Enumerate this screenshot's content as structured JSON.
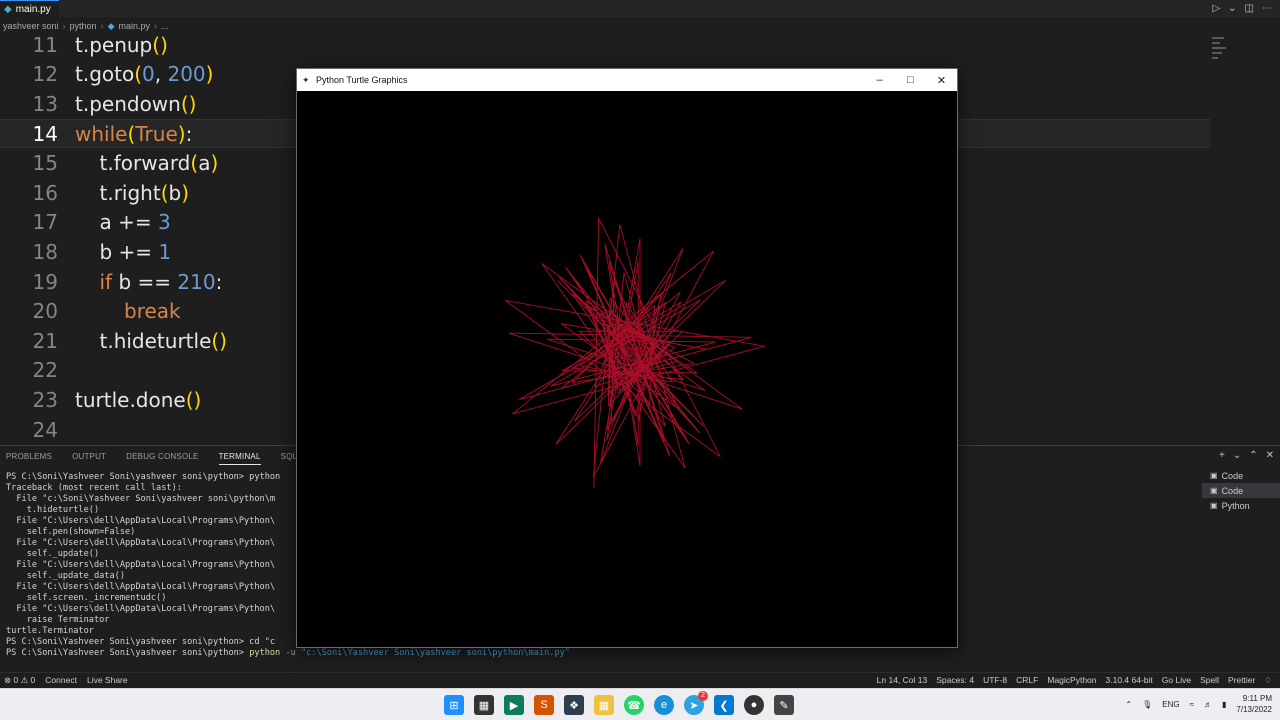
{
  "tab": {
    "icon": "python-file-icon",
    "label": "main.py"
  },
  "breadcrumb": [
    "yashveer soni",
    "python",
    "main.py",
    "..."
  ],
  "code_lines": [
    {
      "n": "11",
      "code": "t.penup()"
    },
    {
      "n": "12",
      "code": "t.goto(0, 200)"
    },
    {
      "n": "13",
      "code": "t.pendown()"
    },
    {
      "n": "14",
      "code": "while(True):"
    },
    {
      "n": "15",
      "code": "t.forward(a)"
    },
    {
      "n": "16",
      "code": "t.right(b)"
    },
    {
      "n": "17",
      "code": "a += 3"
    },
    {
      "n": "18",
      "code": "b += 1"
    },
    {
      "n": "19",
      "code": "if b == 210:"
    },
    {
      "n": "20",
      "code": "break"
    },
    {
      "n": "21",
      "code": "t.hideturtle()"
    },
    {
      "n": "22",
      "code": ""
    },
    {
      "n": "23",
      "code": "turtle.done()"
    },
    {
      "n": "24",
      "code": ""
    }
  ],
  "panel": {
    "tabs": [
      "PROBLEMS",
      "OUTPUT",
      "DEBUG CONSOLE",
      "TERMINAL",
      "SQL CONSOLE"
    ],
    "active_tab": "TERMINAL",
    "terminals": [
      "Code",
      "Code",
      "Python"
    ],
    "terminal_lines": [
      "PS C:\\Soni\\Yashveer Soni\\yashveer soni\\python> python",
      "Traceback (most recent call last):",
      "  File \"c:\\Soni\\Yashveer Soni\\yashveer soni\\python\\m",
      "    t.hideturtle()",
      "  File \"C:\\Users\\dell\\AppData\\Local\\Programs\\Python\\",
      "    self.pen(shown=False)",
      "  File \"C:\\Users\\dell\\AppData\\Local\\Programs\\Python\\",
      "    self._update()",
      "  File \"C:\\Users\\dell\\AppData\\Local\\Programs\\Python\\",
      "    self._update_data()",
      "  File \"C:\\Users\\dell\\AppData\\Local\\Programs\\Python\\",
      "    self.screen._incrementudc()",
      "  File \"C:\\Users\\dell\\AppData\\Local\\Programs\\Python\\",
      "    raise Terminator",
      "turtle.Terminator",
      "PS C:\\Soni\\Yashveer Soni\\yashveer soni\\python> cd \"c"
    ],
    "last_prompt": "PS C:\\Soni\\Yashveer Soni\\yashveer soni\\python> ",
    "last_cmd": "python",
    "last_flag": " -u ",
    "last_arg": "\"c:\\Soni\\Yashveer Soni\\yashveer soni\\python\\main.py\""
  },
  "statusbar": {
    "left": [
      "⊗ 0 ⚠ 0",
      "Connect",
      "Live Share"
    ],
    "right": [
      "Ln 14, Col 13",
      "Spaces: 4",
      "UTF-8",
      "CRLF",
      "MagicPython",
      "3.10.4 64-bit",
      "Go Live",
      "Spell",
      "Prettier"
    ]
  },
  "turtle_window": {
    "title": "Python Turtle Graphics",
    "pen_color": "#c8102e",
    "background": "#000000"
  },
  "taskbar": {
    "lang": "ENG",
    "time": "9:11 PM",
    "date": "7/13/2022",
    "badge": "2"
  }
}
